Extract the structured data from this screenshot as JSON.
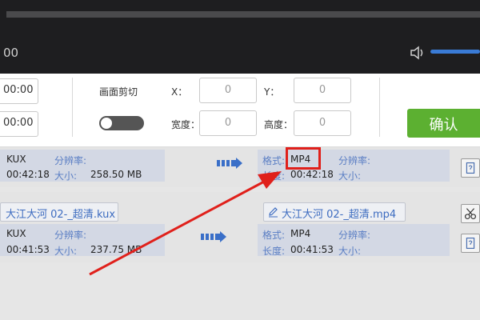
{
  "player": {
    "time": "00"
  },
  "edit": {
    "start_time": "00:00",
    "end_time": "00:00",
    "crop_label": "画面剪切",
    "x_label": "X：",
    "y_label": "Y：",
    "width_label": "宽度：",
    "height_label": "高度：",
    "x_value": "0",
    "y_value": "0",
    "width_value": "0",
    "height_value": "0",
    "confirm_label": "确认"
  },
  "rows": [
    {
      "source": {
        "format": "KUX",
        "resolution_label": "分辨率:",
        "duration": "00:42:18",
        "size_label": "大小:",
        "size": "258.50 MB"
      },
      "output": {
        "format_label": "格式:",
        "format": "MP4",
        "resolution_label": "分辨率:",
        "duration_label": "长度:",
        "duration": "00:42:18",
        "size_label": "大小:"
      }
    },
    {
      "source_name": "大江大河 02-_超清.kux",
      "output_name": "大江大河 02-_超清.mp4",
      "source": {
        "format": "KUX",
        "resolution_label": "分辨率:",
        "duration": "00:41:53",
        "size_label": "大小:",
        "size": "237.75 MB"
      },
      "output": {
        "format_label": "格式:",
        "format": "MP4",
        "resolution_label": "分辨率:",
        "duration_label": "长度:",
        "duration": "00:41:53",
        "size_label": "大小:"
      }
    }
  ],
  "colors": {
    "accent": "#5cb031",
    "highlight": "#e0201b",
    "link": "#3d6cc0"
  },
  "icons": {
    "volume": "speaker-icon",
    "convert": "arrow-right-icon",
    "edit": "pencil-icon",
    "cut": "scissors-icon",
    "help": "help-icon"
  }
}
